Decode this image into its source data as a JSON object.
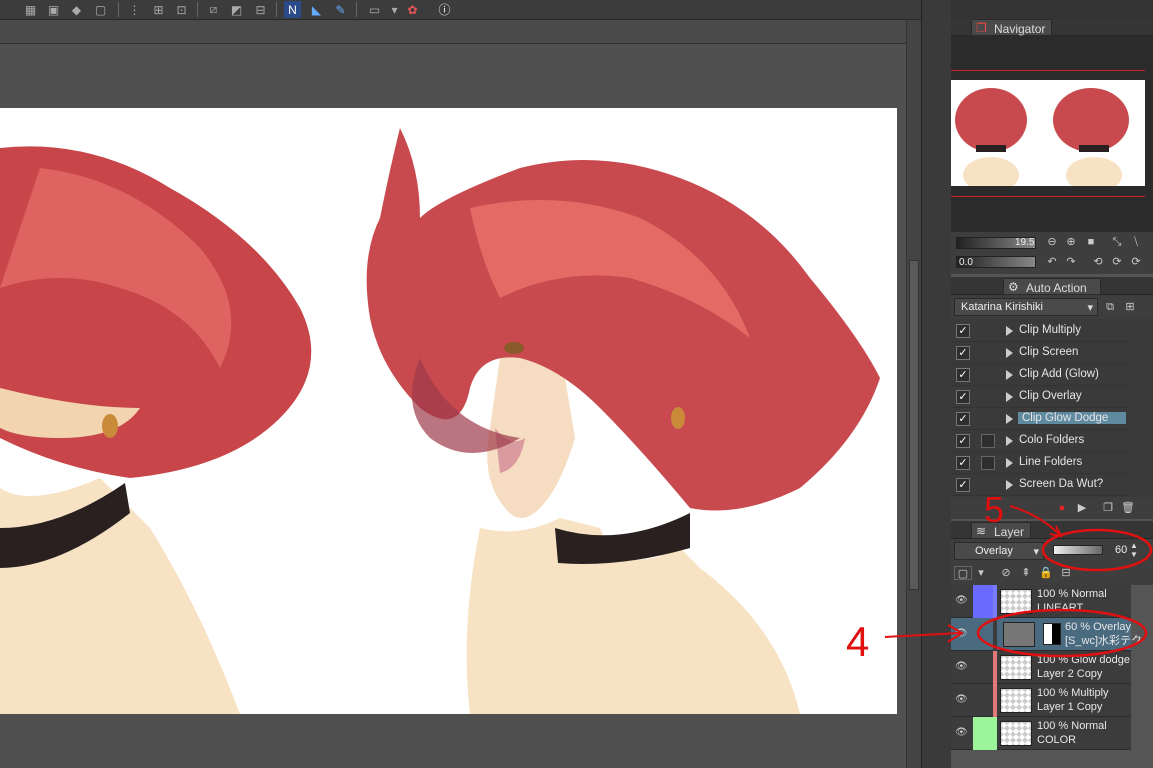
{
  "navigator": {
    "tab_label": "Navigator",
    "zoom_value": "19.5",
    "rotate_value": "0.0"
  },
  "auto_action": {
    "tab_label": "Auto Action",
    "set_name": "Katarina Kirishiki",
    "items": [
      {
        "label": "Clip Multiply",
        "checked": true,
        "selected": false
      },
      {
        "label": "Clip Screen",
        "checked": true,
        "selected": false
      },
      {
        "label": "Clip Add (Glow)",
        "checked": true,
        "selected": false
      },
      {
        "label": "Clip Overlay",
        "checked": true,
        "selected": false
      },
      {
        "label": "Clip Glow Dodge",
        "checked": true,
        "selected": true
      },
      {
        "label": "Colo Folders",
        "checked": true,
        "selected": false
      },
      {
        "label": "Line Folders",
        "checked": true,
        "selected": false
      },
      {
        "label": "Screen Da Wut?",
        "checked": true,
        "selected": false
      }
    ]
  },
  "layer": {
    "tab_label": "Layer",
    "blend_mode": "Overlay",
    "opacity": "60",
    "rows": [
      {
        "line1": "100 % Normal",
        "line2": "LINEART",
        "strip": "#7a7aff"
      },
      {
        "line1": "60 % Overlay",
        "line2": "[S_wc]水彩テク",
        "strip": "#3c3c3c"
      },
      {
        "line1": "100 % Glow dodge",
        "line2": "Layer 2 Copy",
        "strip": "#e07a7a"
      },
      {
        "line1": "100 % Multiply",
        "line2": "Layer 1 Copy",
        "strip": "#e07a7a"
      },
      {
        "line1": "100 % Normal",
        "line2": "COLOR",
        "strip": "#9bf59b"
      }
    ]
  },
  "annotations": {
    "number_5": "5",
    "number_4": "4"
  }
}
